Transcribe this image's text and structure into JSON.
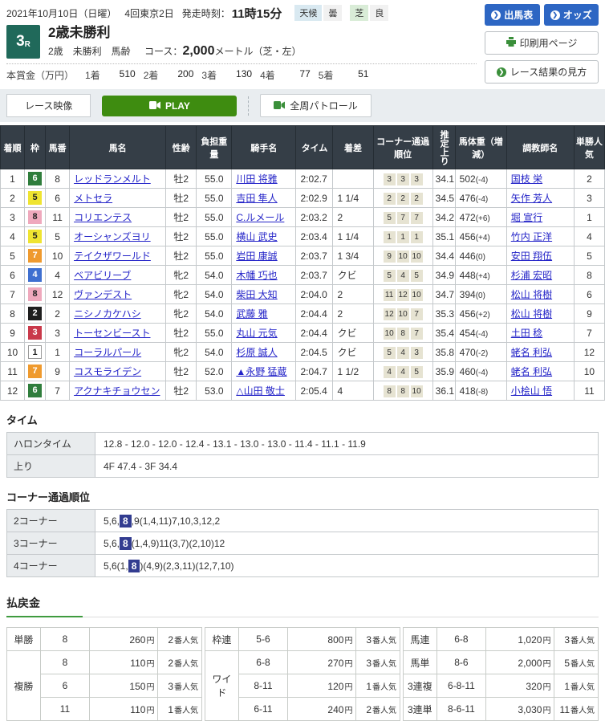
{
  "header": {
    "date": "2021年10月10日（日曜）",
    "meet": "4回東京2日",
    "start_label": "発走時刻：",
    "start_time": "11時15分",
    "weather_label": "天候",
    "weather": "曇",
    "turf_label": "芝",
    "going": "良",
    "entries_btn": "出馬表",
    "odds_btn": "オッズ",
    "print_btn": "印刷用ページ",
    "guide_btn": "レース結果の見方"
  },
  "race": {
    "number": "3",
    "r": "R",
    "title": "2歳未勝利",
    "conditions": "2歳　未勝利　馬齢",
    "course_label": "コース：",
    "distance": "2,000",
    "course_detail": "メートル（芝・左）",
    "prize_label": "本賞金（万円）",
    "prizes": [
      {
        "place": "1着",
        "amount": "510"
      },
      {
        "place": "2着",
        "amount": "200"
      },
      {
        "place": "3着",
        "amount": "130"
      },
      {
        "place": "4着",
        "amount": "77"
      },
      {
        "place": "5着",
        "amount": "51"
      }
    ]
  },
  "video": {
    "label": "レース映像",
    "play": "PLAY",
    "patrol": "全周パトロール"
  },
  "results": {
    "headers": {
      "fin": "着順",
      "frame": "枠",
      "num": "馬番",
      "horse": "馬名",
      "sexage": "性齢",
      "weight": "負担重量",
      "jockey": "騎手名",
      "time": "タイム",
      "margin": "着差",
      "corner": "コーナー通過順位",
      "up": "推定上り",
      "hweight": "馬体重（増減）",
      "trainer": "調教師名",
      "fav": "単勝人気"
    },
    "rows": [
      {
        "fin": "1",
        "frame": "6",
        "num": "8",
        "horse": "レッドランメルト",
        "sexage": "牡2",
        "wt": "55.0",
        "jockey": "川田 将雅",
        "time": "2:02.7",
        "margin": "",
        "c": [
          "3",
          "3",
          "3"
        ],
        "up": "34.1",
        "hw": "502",
        "hwd": "(-4)",
        "trainer": "国枝 栄",
        "fav": "2"
      },
      {
        "fin": "2",
        "frame": "5",
        "num": "6",
        "horse": "メトセラ",
        "sexage": "牡2",
        "wt": "55.0",
        "jockey": "吉田 隼人",
        "time": "2:02.9",
        "margin": "1 1/4",
        "c": [
          "2",
          "2",
          "2"
        ],
        "up": "34.5",
        "hw": "476",
        "hwd": "(-4)",
        "trainer": "矢作 芳人",
        "fav": "3"
      },
      {
        "fin": "3",
        "frame": "8",
        "num": "11",
        "horse": "コリエンテス",
        "sexage": "牡2",
        "wt": "55.0",
        "jockey": "C.ルメール",
        "time": "2:03.2",
        "margin": "2",
        "c": [
          "5",
          "7",
          "7"
        ],
        "up": "34.2",
        "hw": "472",
        "hwd": "(+6)",
        "trainer": "堀 宣行",
        "fav": "1"
      },
      {
        "fin": "4",
        "frame": "5",
        "num": "5",
        "horse": "オーシャンズヨリ",
        "sexage": "牡2",
        "wt": "55.0",
        "jockey": "横山 武史",
        "time": "2:03.4",
        "margin": "1 1/4",
        "c": [
          "1",
          "1",
          "1"
        ],
        "up": "35.1",
        "hw": "456",
        "hwd": "(+4)",
        "trainer": "竹内 正洋",
        "fav": "4"
      },
      {
        "fin": "5",
        "frame": "7",
        "num": "10",
        "horse": "テイクザワールド",
        "sexage": "牡2",
        "wt": "55.0",
        "jockey": "岩田 康誠",
        "time": "2:03.7",
        "margin": "1 3/4",
        "c": [
          "9",
          "10",
          "10"
        ],
        "up": "34.4",
        "hw": "446",
        "hwd": "(0)",
        "trainer": "安田 翔伍",
        "fav": "5"
      },
      {
        "fin": "6",
        "frame": "4",
        "num": "4",
        "horse": "ベアビリーブ",
        "sexage": "牝2",
        "wt": "54.0",
        "jockey": "木幡 巧也",
        "time": "2:03.7",
        "margin": "クビ",
        "c": [
          "5",
          "4",
          "5"
        ],
        "up": "34.9",
        "hw": "448",
        "hwd": "(+4)",
        "trainer": "杉浦 宏昭",
        "fav": "8"
      },
      {
        "fin": "7",
        "frame": "8",
        "num": "12",
        "horse": "ヴァンデスト",
        "sexage": "牝2",
        "wt": "54.0",
        "jockey": "柴田 大知",
        "time": "2:04.0",
        "margin": "2",
        "c": [
          "11",
          "12",
          "10"
        ],
        "up": "34.7",
        "hw": "394",
        "hwd": "(0)",
        "trainer": "松山 将樹",
        "fav": "6"
      },
      {
        "fin": "8",
        "frame": "2",
        "num": "2",
        "horse": "ニシノカケハシ",
        "sexage": "牝2",
        "wt": "54.0",
        "jockey": "武藤 雅",
        "time": "2:04.4",
        "margin": "2",
        "c": [
          "12",
          "10",
          "7"
        ],
        "up": "35.3",
        "hw": "456",
        "hwd": "(+2)",
        "trainer": "松山 将樹",
        "fav": "9"
      },
      {
        "fin": "9",
        "frame": "3",
        "num": "3",
        "horse": "トーセンビースト",
        "sexage": "牡2",
        "wt": "55.0",
        "jockey": "丸山 元気",
        "time": "2:04.4",
        "margin": "クビ",
        "c": [
          "10",
          "8",
          "7"
        ],
        "up": "35.4",
        "hw": "454",
        "hwd": "(-4)",
        "trainer": "土田 稔",
        "fav": "7"
      },
      {
        "fin": "10",
        "frame": "1",
        "num": "1",
        "horse": "コーラルパール",
        "sexage": "牝2",
        "wt": "54.0",
        "jockey": "杉原 誠人",
        "time": "2:04.5",
        "margin": "クビ",
        "c": [
          "5",
          "4",
          "3"
        ],
        "up": "35.8",
        "hw": "470",
        "hwd": "(-2)",
        "trainer": "蛯名 利弘",
        "fav": "12"
      },
      {
        "fin": "11",
        "frame": "7",
        "num": "9",
        "horse": "コスモライデン",
        "sexage": "牡2",
        "wt": "52.0",
        "jockey": "▲永野 猛蔵",
        "time": "2:04.7",
        "margin": "1 1/2",
        "c": [
          "4",
          "4",
          "5"
        ],
        "up": "35.9",
        "hw": "460",
        "hwd": "(-4)",
        "trainer": "蛯名 利弘",
        "fav": "10"
      },
      {
        "fin": "12",
        "frame": "6",
        "num": "7",
        "horse": "アクナキチョウセン",
        "sexage": "牡2",
        "wt": "53.0",
        "jockey": "△山田 敬士",
        "time": "2:05.4",
        "margin": "4",
        "c": [
          "8",
          "8",
          "10"
        ],
        "up": "36.1",
        "hw": "418",
        "hwd": "(-8)",
        "trainer": "小桧山 悟",
        "fav": "11"
      }
    ]
  },
  "time_section": {
    "title": "タイム",
    "rows": [
      {
        "label": "ハロンタイム",
        "value": "12.8 - 12.0 - 12.0 - 12.4 - 13.1 - 13.0 - 13.0 - 11.4 - 11.1 - 11.9"
      },
      {
        "label": "上り",
        "value": "4F 47.4 - 3F 34.4"
      }
    ]
  },
  "corner_section": {
    "title": "コーナー通過順位",
    "rows": [
      {
        "label": "2コーナー",
        "pre": "5,6,",
        "hl": "8",
        "post": ",9(1,4,11)7,10,3,12,2"
      },
      {
        "label": "3コーナー",
        "pre": "5,6,",
        "hl": "8",
        "post": "(1,4,9)11(3,7)(2,10)12"
      },
      {
        "label": "4コーナー",
        "pre": "5,6(1,",
        "hl": "8",
        "post": ")(4,9)(2,3,11)(12,7,10)"
      }
    ]
  },
  "payout": {
    "title": "払戻金",
    "yen": "円",
    "fav_suffix": "番人気",
    "tansho_label": "単勝",
    "fukusho_label": "複勝",
    "wakuren_label": "枠連",
    "wide_label": "ワイド",
    "umaren_label": "馬連",
    "umatan_label": "馬単",
    "sanrenpuku_label": "3連複",
    "sanrentan_label": "3連単",
    "tansho": {
      "comb": "8",
      "amount": "260",
      "fav": "2"
    },
    "fukusho": [
      {
        "comb": "8",
        "amount": "110",
        "fav": "2"
      },
      {
        "comb": "6",
        "amount": "150",
        "fav": "3"
      },
      {
        "comb": "11",
        "amount": "110",
        "fav": "1"
      }
    ],
    "wakuren": {
      "comb": "5-6",
      "amount": "800",
      "fav": "3"
    },
    "wide": [
      {
        "comb": "6-8",
        "amount": "270",
        "fav": "3"
      },
      {
        "comb": "8-11",
        "amount": "120",
        "fav": "1"
      },
      {
        "comb": "6-11",
        "amount": "240",
        "fav": "2"
      }
    ],
    "umaren": {
      "comb": "6-8",
      "amount": "1,020",
      "fav": "3"
    },
    "umatan": {
      "comb": "8-6",
      "amount": "2,000",
      "fav": "5"
    },
    "sanrenpuku": {
      "comb": "6-8-11",
      "amount": "320",
      "fav": "1"
    },
    "sanrentan": {
      "comb": "8-6-11",
      "amount": "3,030",
      "fav": "11"
    }
  }
}
